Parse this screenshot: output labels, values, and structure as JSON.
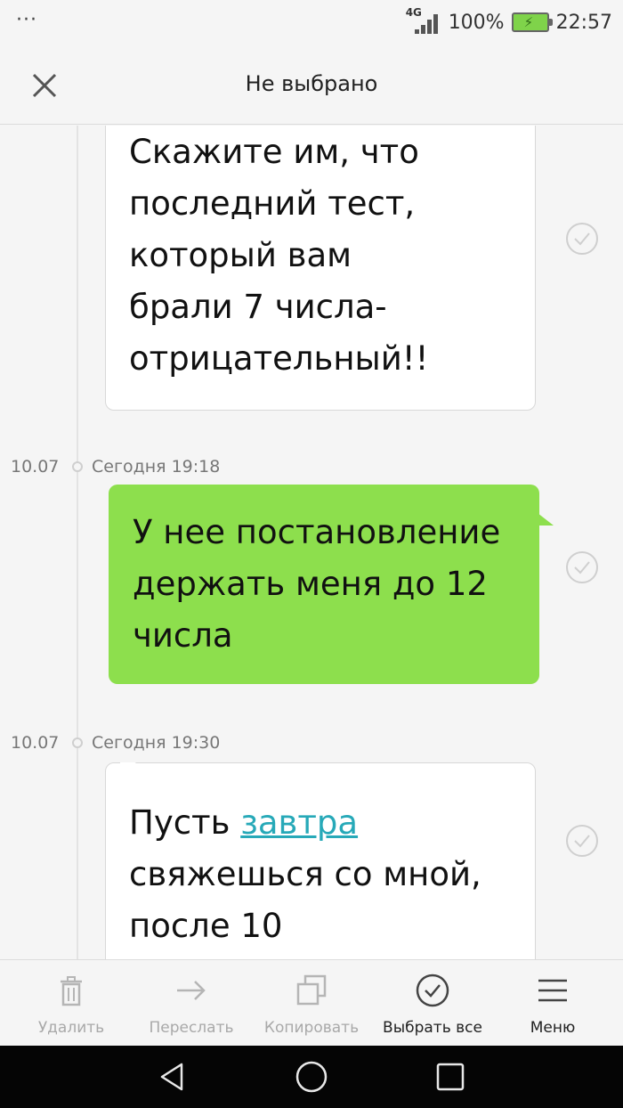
{
  "status_bar": {
    "menu_dots": "···",
    "network": "4G",
    "battery_percent": "100%",
    "time": "22:57"
  },
  "header": {
    "title": "Не выбрано"
  },
  "messages": [
    {
      "direction": "incoming",
      "lines": [
        "Скажите им, что",
        "последний тест,",
        "который вам",
        "брали 7 числа-",
        "отрицательный!!"
      ]
    },
    {
      "direction": "outgoing",
      "date": "10.07",
      "time": "Сегодня 19:18",
      "lines": [
        "У нее постановление",
        "держать меня до 12",
        "числа"
      ]
    },
    {
      "direction": "incoming",
      "date": "10.07",
      "time": "Сегодня 19:30",
      "line1_before": "Пусть ",
      "line1_link": "завтра",
      "lines_rest": [
        "свяжешься со мной,",
        "после 10"
      ]
    }
  ],
  "toolbar": {
    "delete": "Удалить",
    "forward": "Переслать",
    "copy": "Копировать",
    "select_all": "Выбрать все",
    "menu": "Меню"
  },
  "colors": {
    "outgoing_bubble": "#8ddf4d",
    "link": "#27a9b8",
    "battery": "#7fd34a"
  }
}
